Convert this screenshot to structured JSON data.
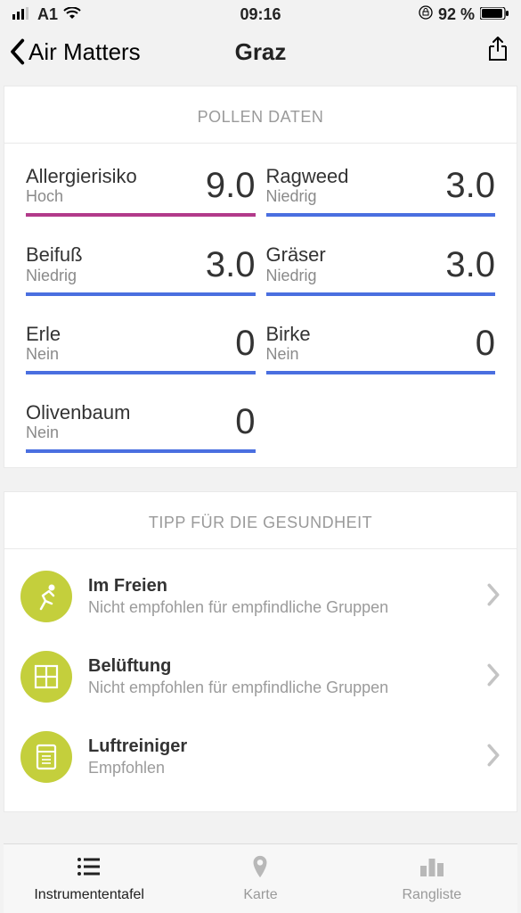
{
  "statusbar": {
    "carrier": "A1",
    "time": "09:16",
    "battery": "92 %"
  },
  "nav": {
    "back": "Air Matters",
    "title": "Graz"
  },
  "pollen": {
    "header": "POLLEN DATEN",
    "items": [
      {
        "name": "Allergierisiko",
        "level": "Hoch",
        "value": "9.0",
        "high": true
      },
      {
        "name": "Ragweed",
        "level": "Niedrig",
        "value": "3.0",
        "high": false
      },
      {
        "name": "Beifuß",
        "level": "Niedrig",
        "value": "3.0",
        "high": false
      },
      {
        "name": "Gräser",
        "level": "Niedrig",
        "value": "3.0",
        "high": false
      },
      {
        "name": "Erle",
        "level": "Nein",
        "value": "0",
        "high": false
      },
      {
        "name": "Birke",
        "level": "Nein",
        "value": "0",
        "high": false
      },
      {
        "name": "Olivenbaum",
        "level": "Nein",
        "value": "0",
        "high": false
      }
    ]
  },
  "tips": {
    "header": "TIPP FÜR DIE GESUNDHEIT",
    "items": [
      {
        "icon": "runner",
        "title": "Im Freien",
        "sub": "Nicht empfohlen für empfindliche Gruppen"
      },
      {
        "icon": "window",
        "title": "Belüftung",
        "sub": "Nicht empfohlen für empfindliche Gruppen"
      },
      {
        "icon": "purifier",
        "title": "Luftreiniger",
        "sub": "Empfohlen"
      }
    ]
  },
  "tabs": {
    "items": [
      {
        "label": "Instrumententafel",
        "active": true
      },
      {
        "label": "Karte",
        "active": false
      },
      {
        "label": "Rangliste",
        "active": false
      }
    ]
  }
}
